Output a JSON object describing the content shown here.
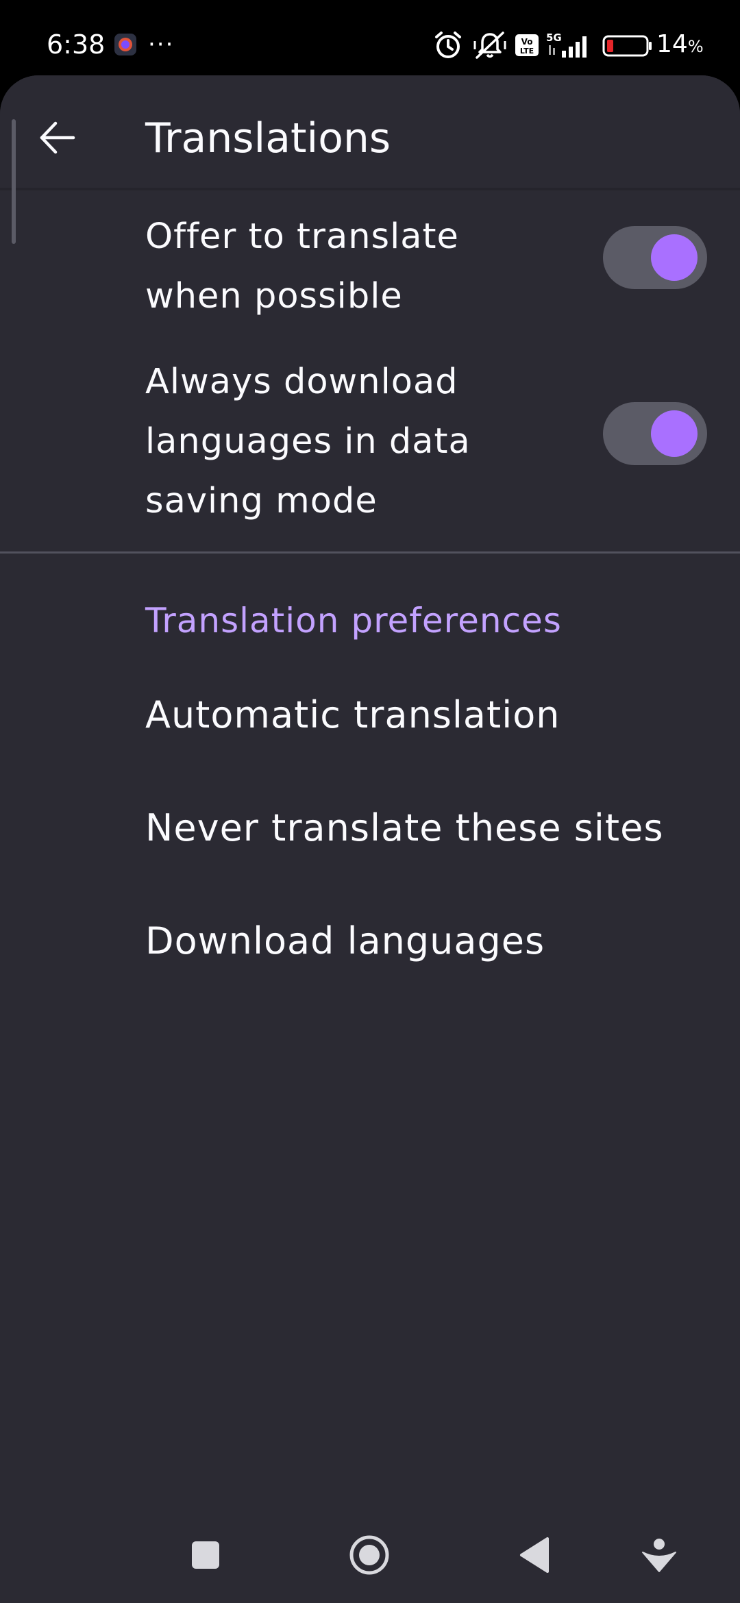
{
  "status_bar": {
    "time": "6:38",
    "more_indicator": "···",
    "battery_percent": "14",
    "battery_unit": "%",
    "icons": [
      "app-notification-icon",
      "alarm-icon",
      "vibrate-off-icon",
      "volte-icon",
      "5g-signal-icon",
      "battery-low-icon"
    ]
  },
  "header": {
    "title": "Translations",
    "back_icon": "arrow-left-icon"
  },
  "settings": {
    "offer_translate": {
      "label": "Offer to translate when possible",
      "enabled": true
    },
    "always_download": {
      "label": "Always download languages in data saving mode",
      "enabled": true
    }
  },
  "preferences": {
    "header": "Translation preferences",
    "items": [
      {
        "label": "Automatic translation"
      },
      {
        "label": "Never translate these sites"
      },
      {
        "label": "Download languages"
      }
    ]
  },
  "nav_bar": {
    "icons": [
      "recents-square-icon",
      "home-circle-icon",
      "back-triangle-icon",
      "assistant-down-icon"
    ]
  },
  "colors": {
    "background": "#2b2a33",
    "accent": "#a970ff",
    "section_header": "#c3a2ff",
    "toggle_track": "#5b5b66",
    "text": "#fbfbfe"
  }
}
